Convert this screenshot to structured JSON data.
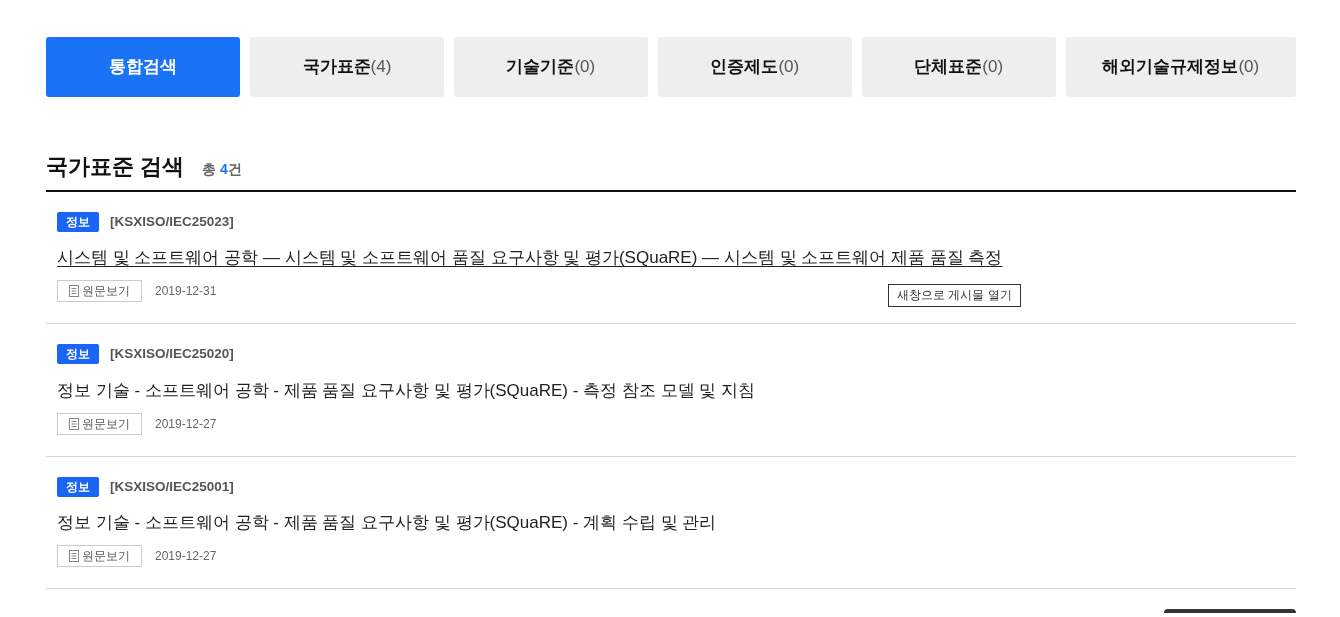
{
  "tabs": [
    {
      "label": "통합검색",
      "selected": true
    },
    {
      "label": "국가표준",
      "count": "(4)",
      "selected": false
    },
    {
      "label": "기술기준",
      "count": "(0)",
      "selected": false
    },
    {
      "label": "인증제도",
      "count": "(0)",
      "selected": false
    },
    {
      "label": "단체표준",
      "count": "(0)",
      "selected": false
    },
    {
      "label": "해외기술규제정보",
      "count": "(0)",
      "selected": false
    }
  ],
  "section": {
    "title": "국가표준 검색",
    "total_prefix": "총",
    "total_count": "4",
    "total_unit": "건"
  },
  "results": [
    {
      "badge": "정보",
      "code": "[KSXISO/IEC25023]",
      "title": "시스템 및 소프트웨어 공학 — 시스템 및 소프트웨어 품질 요구사항 및 평가(SQuaRE) — 시스템 및 소프트웨어 제품 품질 측정",
      "hovered": true,
      "tooltip": "새창으로 게시물 열기",
      "button": "원문보기",
      "date": "2019-12-31"
    },
    {
      "badge": "정보",
      "code": "[KSXISO/IEC25020]",
      "title": "정보 기술 - 소프트웨어 공학 - 제품 품질 요구사항 및 평가(SQuaRE) - 측정 참조 모델 및 지침",
      "hovered": false,
      "button": "원문보기",
      "date": "2019-12-27"
    },
    {
      "badge": "정보",
      "code": "[KSXISO/IEC25001]",
      "title": "정보 기술 - 소프트웨어 공학 - 제품 품질 요구사항 및 평가(SQuaRE) - 계획 수립 및 관리",
      "hovered": false,
      "button": "원문보기",
      "date": "2019-12-27"
    }
  ]
}
